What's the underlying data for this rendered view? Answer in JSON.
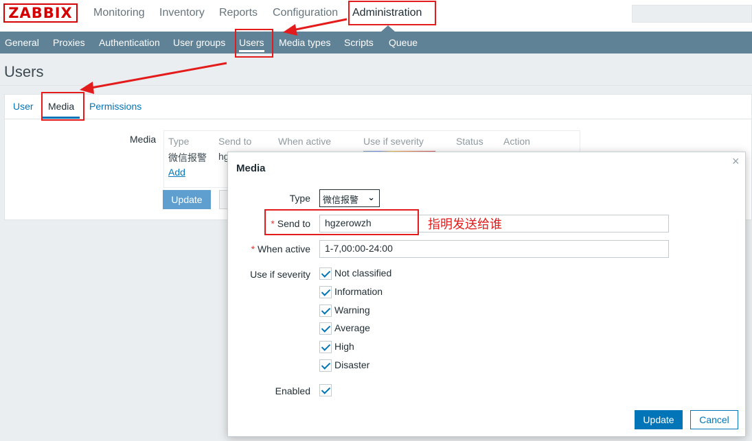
{
  "logo": "ZABBIX",
  "top_nav": [
    "Monitoring",
    "Inventory",
    "Reports",
    "Configuration",
    "Administration"
  ],
  "sub_nav": [
    "General",
    "Proxies",
    "Authentication",
    "User groups",
    "Users",
    "Media types",
    "Scripts",
    "Queue"
  ],
  "page_title": "Users",
  "tabs": [
    "User",
    "Media",
    "Permissions"
  ],
  "media_section": {
    "label": "Media",
    "columns": [
      "Type",
      "Send to",
      "When active",
      "Use if severity",
      "Status",
      "Action"
    ],
    "row": {
      "type": "微信报警",
      "send_to": "hg"
    },
    "add_label": "Add"
  },
  "bg_update_label": "Update",
  "modal": {
    "title": "Media",
    "close_symbol": "×",
    "type_label": "Type",
    "type_value": "微信报警",
    "chevron": "⌄",
    "required_mark": "*",
    "send_to_label": "Send to",
    "send_to_value": "hgzerowzh",
    "when_active_label": "When active",
    "when_active_value": "1-7,00:00-24:00",
    "severity_label": "Use if severity",
    "severities": [
      "Not classified",
      "Information",
      "Warning",
      "Average",
      "High",
      "Disaster"
    ],
    "enabled_label": "Enabled",
    "update_label": "Update",
    "cancel_label": "Cancel"
  },
  "annotation_text": "指明发送给谁",
  "colors": {
    "subnav_bg": "#5f8297",
    "link_blue": "#0275b8",
    "annotation_red": "#e31b1b",
    "logo_red": "#d40000"
  }
}
